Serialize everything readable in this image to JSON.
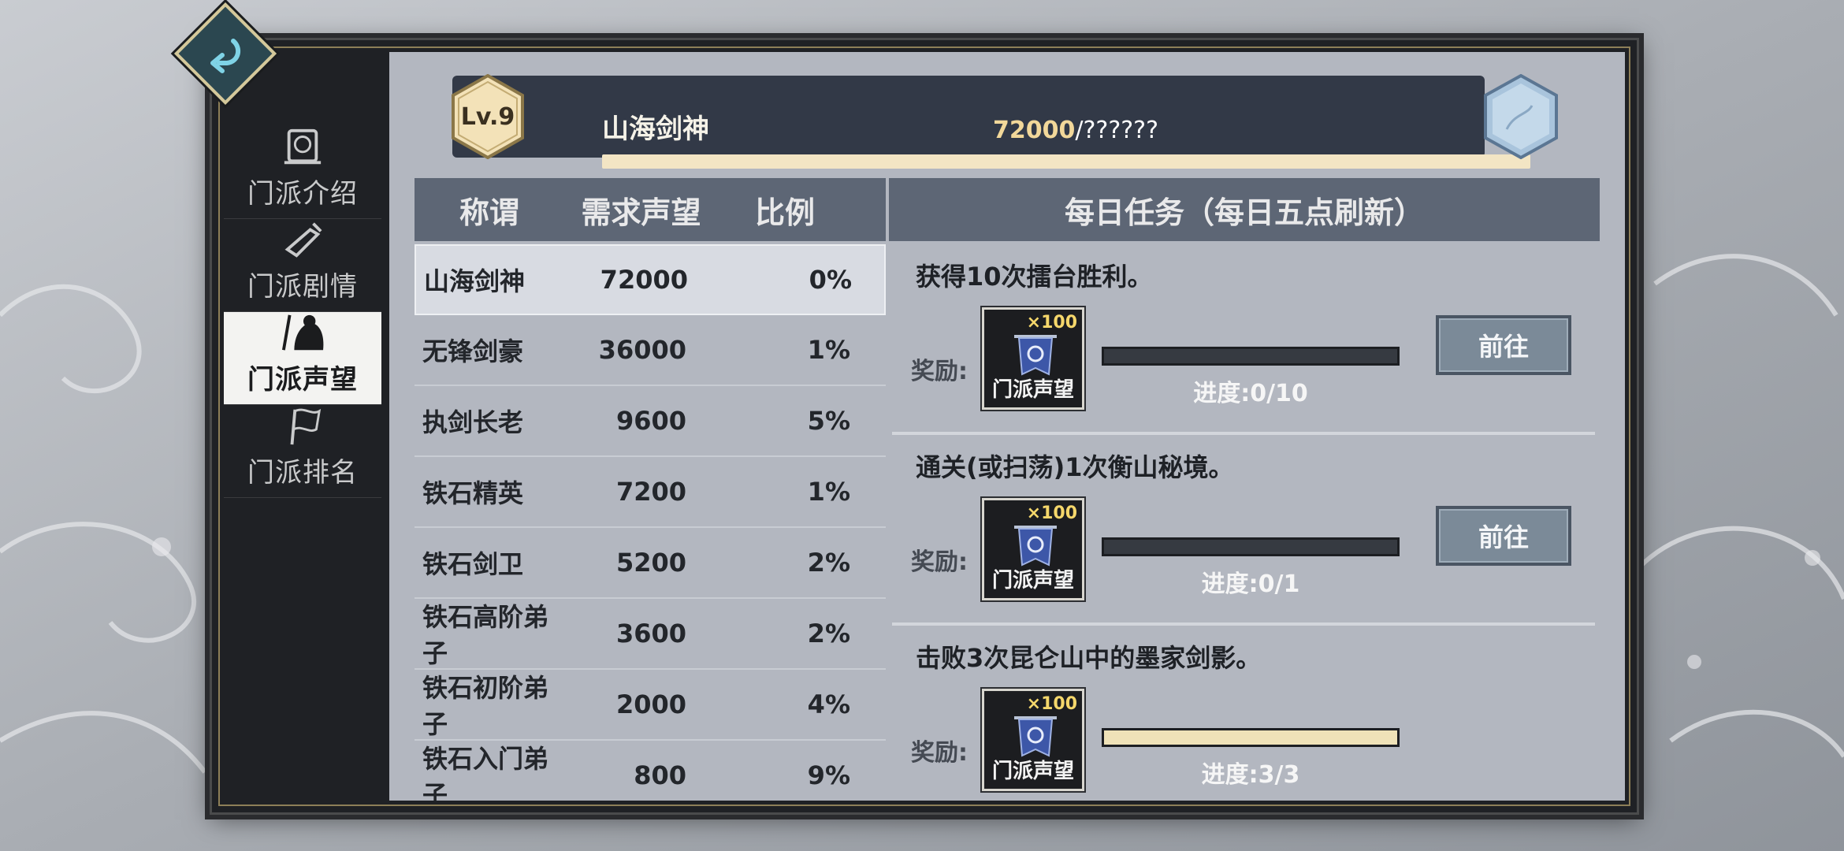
{
  "sidebar": {
    "items": [
      {
        "label": "门派介绍",
        "icon": "scroll-medallion-icon",
        "active": false
      },
      {
        "label": "门派剧情",
        "icon": "quill-scroll-icon",
        "active": false
      },
      {
        "label": "门派声望",
        "icon": "warrior-banner-icon",
        "active": true
      },
      {
        "label": "门派排名",
        "icon": "ranking-flag-icon",
        "active": false
      }
    ]
  },
  "level": {
    "badge": "Lv.9",
    "title": "山海剑神",
    "current": "72000",
    "max": "/??????",
    "fill_fraction": 1.0
  },
  "titles_table": {
    "headers": [
      "称谓",
      "需求声望",
      "比例"
    ],
    "rows": [
      {
        "name": "山海剑神",
        "required": "72000",
        "ratio": "0%"
      },
      {
        "name": "无锋剑豪",
        "required": "36000",
        "ratio": "1%"
      },
      {
        "name": "执剑长老",
        "required": "9600",
        "ratio": "5%"
      },
      {
        "name": "铁石精英",
        "required": "7200",
        "ratio": "1%"
      },
      {
        "name": "铁石剑卫",
        "required": "5200",
        "ratio": "2%"
      },
      {
        "name": "铁石高阶弟子",
        "required": "3600",
        "ratio": "2%"
      },
      {
        "name": "铁石初阶弟子",
        "required": "2000",
        "ratio": "4%"
      },
      {
        "name": "铁石入门弟子",
        "required": "800",
        "ratio": "9%"
      }
    ]
  },
  "daily": {
    "header": "每日任务（每日五点刷新）",
    "reward_label": "奖励:",
    "go_label": "前往",
    "tasks": [
      {
        "desc": "获得10次擂台胜利。",
        "reward_qty": "×100",
        "reward_name": "门派声望",
        "progress": "进度:0/10",
        "fill_fraction": 0.0,
        "has_button": true
      },
      {
        "desc": "通关(或扫荡)1次衡山秘境。",
        "reward_qty": "×100",
        "reward_name": "门派声望",
        "progress": "进度:0/1",
        "fill_fraction": 0.0,
        "has_button": true
      },
      {
        "desc": "击败3次昆仑山中的墨家剑影。",
        "reward_qty": "×100",
        "reward_name": "门派声望",
        "progress": "进度:3/3",
        "fill_fraction": 1.0,
        "has_button": false
      }
    ]
  },
  "colors": {
    "accent_gold": "#f2d89a",
    "panel": "#b3b7c0",
    "header": "#5d6675",
    "progress_fill": "#efe2b8"
  },
  "icons": {
    "back": "back-arrow-icon",
    "gem": "blue-hex-gem-icon",
    "reward": "sect-banner-icon"
  }
}
